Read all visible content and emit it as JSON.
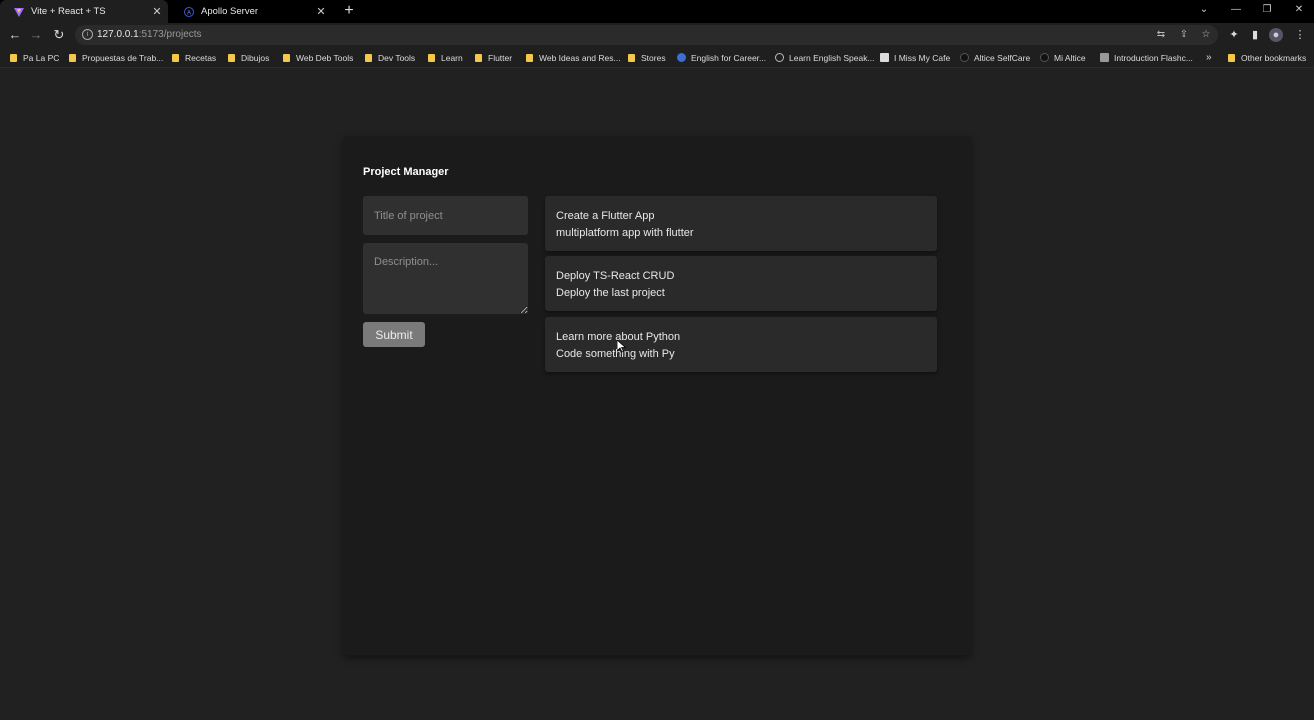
{
  "browser": {
    "tabs": [
      {
        "label": "Vite + React + TS",
        "active": true
      },
      {
        "label": "Apollo Server",
        "active": false
      }
    ],
    "new_tab_label": "+",
    "url_host": "127.0.0.1",
    "url_path": ":5173/projects",
    "bookmarks": [
      "Pa La PC",
      "Propuestas de Trab...",
      "Recetas",
      "Dibujos",
      "Web Deb Tools",
      "Dev Tools",
      "Learn",
      "Flutter",
      "Web Ideas and Res...",
      "Stores",
      "English for Career...",
      "Learn English Speak...",
      "I Miss My Cafe",
      "Altice SelfCare",
      "Mi Altice",
      "Introduction Flashc..."
    ],
    "overflow_label": "»",
    "other_bookmarks": "Other bookmarks"
  },
  "app": {
    "title": "Project Manager",
    "form": {
      "title_placeholder": "Title of project",
      "description_placeholder": "Description...",
      "submit_label": "Submit"
    },
    "projects": [
      {
        "name": "Create a Flutter App",
        "description": "multiplatform app with flutter"
      },
      {
        "name": "Deploy TS-React CRUD",
        "description": "Deploy the last project"
      },
      {
        "name": "Learn more about Python",
        "description": "Code something with Py"
      }
    ]
  },
  "colors": {
    "background": "#212121",
    "card": "#1b1b1b",
    "input": "#303030",
    "submit": "#7a7a7a",
    "bookmark_folder": "#f3c84c"
  }
}
